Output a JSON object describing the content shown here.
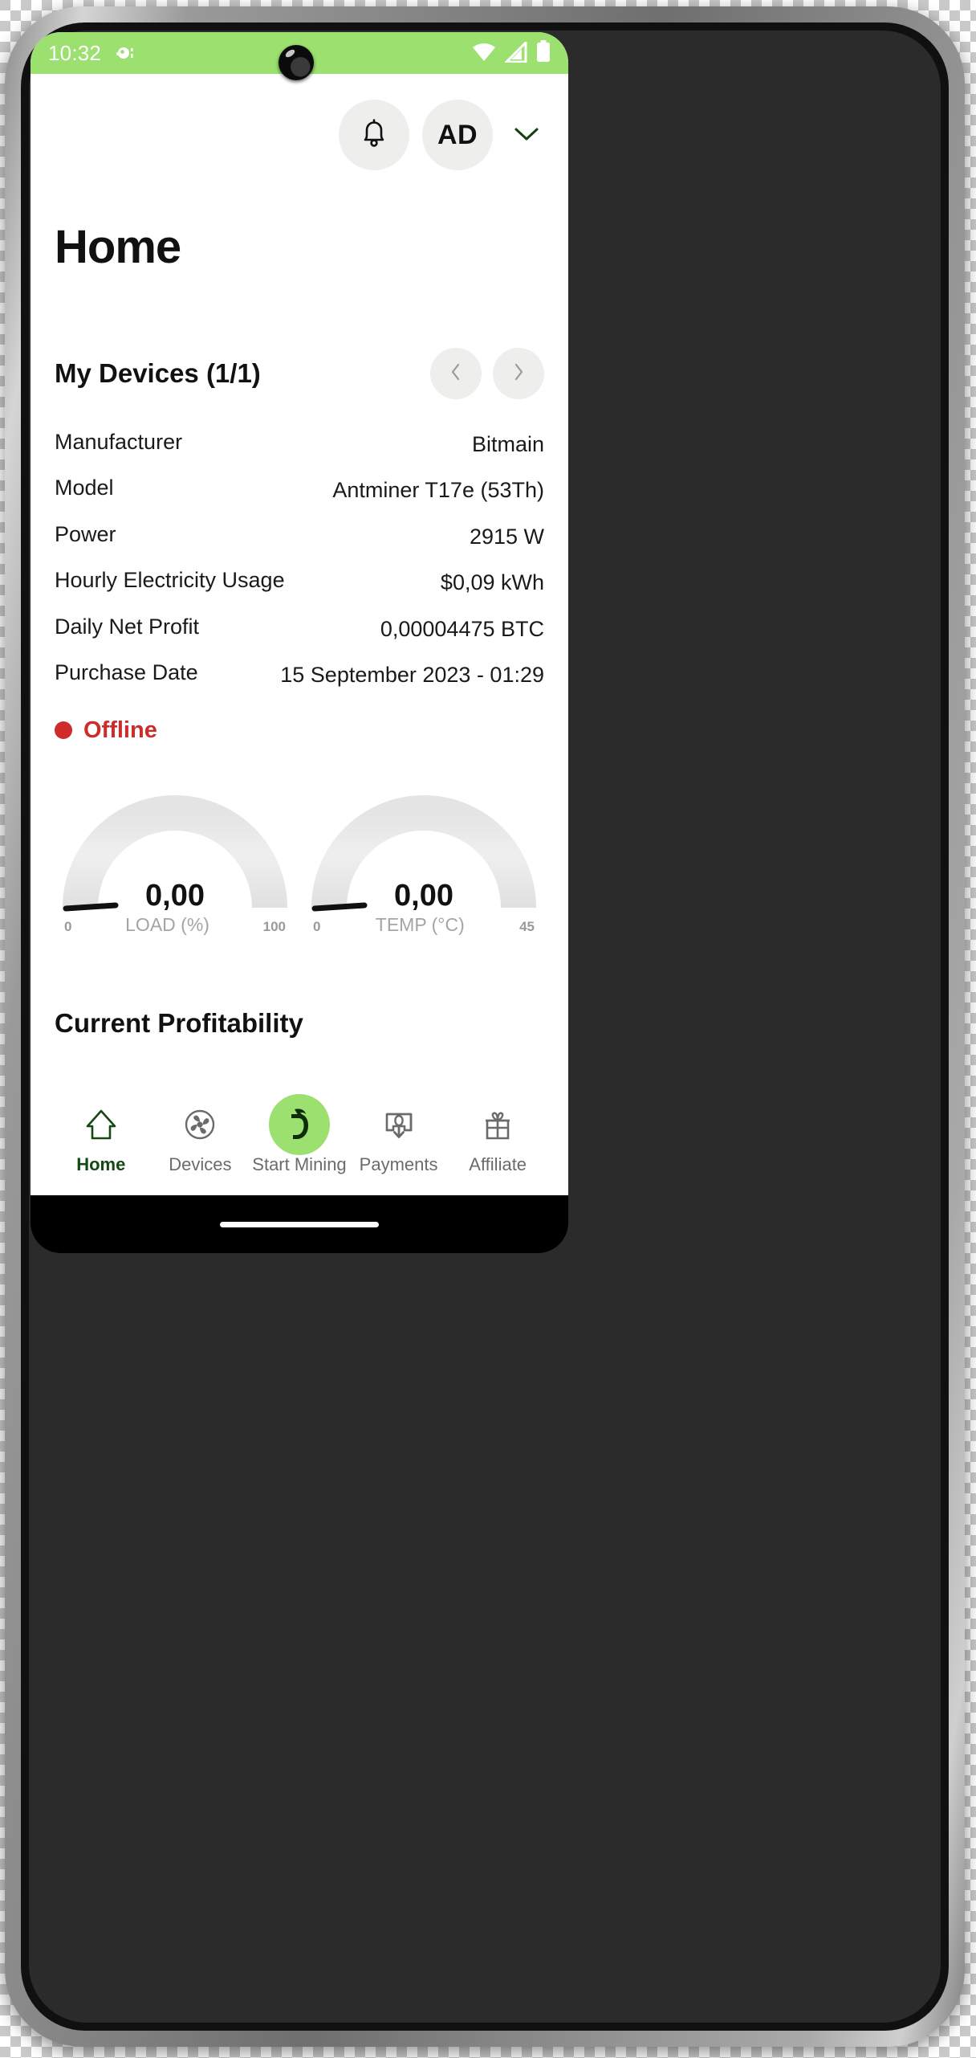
{
  "status_bar": {
    "time": "10:32",
    "left_icon": "camera-dot-icon",
    "right_icons": [
      "wifi-icon",
      "cellular-signal-icon",
      "battery-icon"
    ],
    "background_color": "#9ce170"
  },
  "header": {
    "notification_icon": "bell-icon",
    "avatar_initials": "AD",
    "dropdown_icon": "chevron-down-icon",
    "dropdown_color": "#15400f"
  },
  "page": {
    "title": "Home"
  },
  "devices_section": {
    "title": "My Devices (1/1)",
    "prev_icon": "chevron-left-icon",
    "next_icon": "chevron-right-icon",
    "specs": [
      {
        "label": "Manufacturer",
        "value": "Bitmain"
      },
      {
        "label": "Model",
        "value": "Antminer T17e (53Th)"
      },
      {
        "label": "Power",
        "value": "2915 W"
      },
      {
        "label": "Hourly Electricity Usage",
        "value": "$0,09 kWh"
      },
      {
        "label": "Daily Net Profit",
        "value": "0,00004475 BTC"
      },
      {
        "label": "Purchase Date",
        "value": "15 September 2023 - 01:29"
      }
    ],
    "status": {
      "label": "Offline",
      "color": "#ce2b2b",
      "dot_icon": "status-dot-icon"
    }
  },
  "chart_data": [
    {
      "type": "gauge",
      "title": "LOAD (%)",
      "value": "0,00",
      "value_numeric": 0,
      "min": 0,
      "max": 100,
      "min_label": "0",
      "max_label": "100",
      "track_color": "#ececec",
      "needle_color": "#111111"
    },
    {
      "type": "gauge",
      "title": "TEMP (°C)",
      "value": "0,00",
      "value_numeric": 0,
      "min": 0,
      "max": 45,
      "min_label": "0",
      "max_label": "45",
      "track_color": "#ececec",
      "needle_color": "#111111"
    }
  ],
  "profitability": {
    "title": "Current Profitability"
  },
  "bottom_nav": {
    "items": [
      {
        "label": "Home",
        "icon": "home-icon",
        "active": true
      },
      {
        "label": "Devices",
        "icon": "fan-icon",
        "active": false
      },
      {
        "label": "Start Mining",
        "icon": "mining-logo-icon",
        "active": false
      },
      {
        "label": "Payments",
        "icon": "payment-withdraw-icon",
        "active": false
      },
      {
        "label": "Affiliate",
        "icon": "gift-icon",
        "active": false
      }
    ],
    "accent_color": "#9ce170",
    "active_color": "#134a12"
  },
  "system": {
    "gesture_bar": "gesture-pill"
  }
}
